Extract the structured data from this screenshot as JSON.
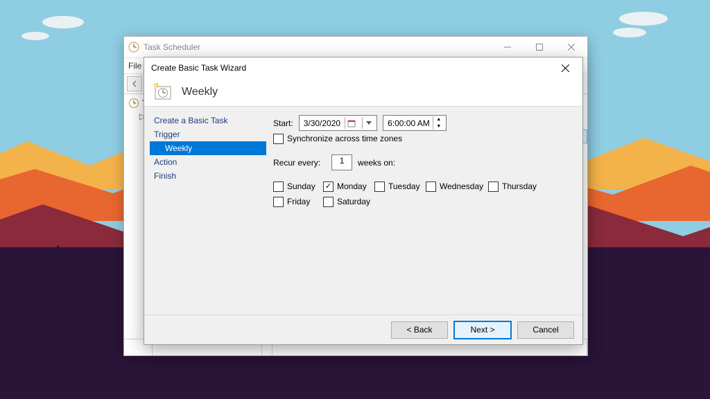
{
  "parent": {
    "title": "Task Scheduler",
    "menu": {
      "file": "File"
    },
    "tree": {
      "root": "Task Scheduler (Local)",
      "root_short": "Tas",
      "child_short": "T"
    }
  },
  "wizard": {
    "title": "Create Basic Task Wizard",
    "header": "Weekly",
    "steps": {
      "create": "Create a Basic Task",
      "trigger": "Trigger",
      "weekly": "Weekly",
      "action": "Action",
      "finish": "Finish"
    },
    "start_label": "Start:",
    "start_date": "3/30/2020",
    "start_time": "6:00:00 AM",
    "sync_label": "Synchronize across time zones",
    "sync_checked": false,
    "recur_label_1": "Recur every:",
    "recur_value": "1",
    "recur_label_2": "weeks on:",
    "days": [
      {
        "label": "Sunday",
        "checked": false
      },
      {
        "label": "Monday",
        "checked": true
      },
      {
        "label": "Tuesday",
        "checked": false
      },
      {
        "label": "Wednesday",
        "checked": false
      },
      {
        "label": "Thursday",
        "checked": false
      },
      {
        "label": "Friday",
        "checked": false
      },
      {
        "label": "Saturday",
        "checked": false
      }
    ],
    "buttons": {
      "back": "< Back",
      "next": "Next >",
      "cancel": "Cancel"
    }
  }
}
